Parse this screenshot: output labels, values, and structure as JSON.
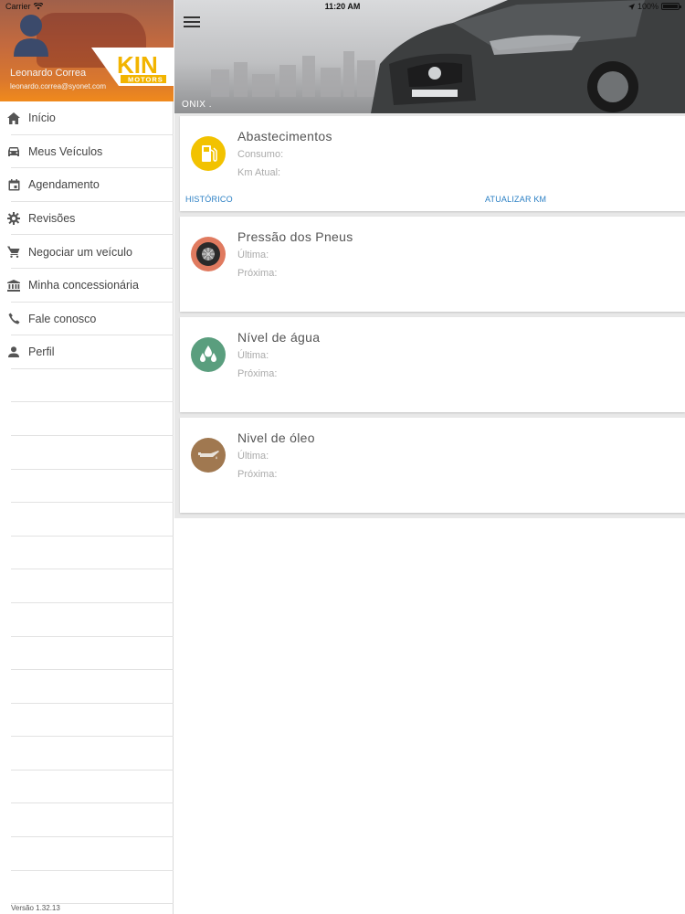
{
  "status_bar": {
    "carrier": "Carrier",
    "time": "11:20 AM",
    "battery": "100%"
  },
  "drawer": {
    "user_name": "Leonardo Correa",
    "user_email": "leonardo.correa@syonet.com",
    "logo_text": "KIN",
    "logo_subtext": "MOTORS",
    "items": [
      {
        "label": "Início",
        "icon": "home-icon"
      },
      {
        "label": "Meus Veículos",
        "icon": "car-icon"
      },
      {
        "label": "Agendamento",
        "icon": "calendar-icon"
      },
      {
        "label": "Revisões",
        "icon": "gear-icon"
      },
      {
        "label": "Negociar um veículo",
        "icon": "cart-icon"
      },
      {
        "label": "Minha concessionária",
        "icon": "bank-icon"
      },
      {
        "label": "Fale conosco",
        "icon": "phone-icon"
      },
      {
        "label": "Perfil",
        "icon": "person-icon"
      }
    ],
    "version": "Versão 1.32.13"
  },
  "hero": {
    "vehicle_label": "ONIX ."
  },
  "cards": [
    {
      "title": "Abastecimentos",
      "line1": "Consumo:",
      "line2": "Km  Atual:",
      "link_left": "HISTÓRICO",
      "link_right": "ATUALIZAR KM",
      "icon": "fuel-icon",
      "color": "#f2c200"
    },
    {
      "title": "Pressão dos Pneus",
      "line1": "Última:",
      "line2": "Próxima:",
      "icon": "tire-icon",
      "color": "#e07a5f"
    },
    {
      "title": "Nível de água",
      "line1": "Última:",
      "line2": "Próxima:",
      "icon": "water-drops-icon",
      "color": "#5a9e7e"
    },
    {
      "title": "Nivel de óleo",
      "line1": "Última:",
      "line2": "Próxima:",
      "icon": "oil-can-icon",
      "color": "#a07850"
    }
  ],
  "colors": {
    "accent": "#f08a1c",
    "link": "#2a7fc4"
  }
}
